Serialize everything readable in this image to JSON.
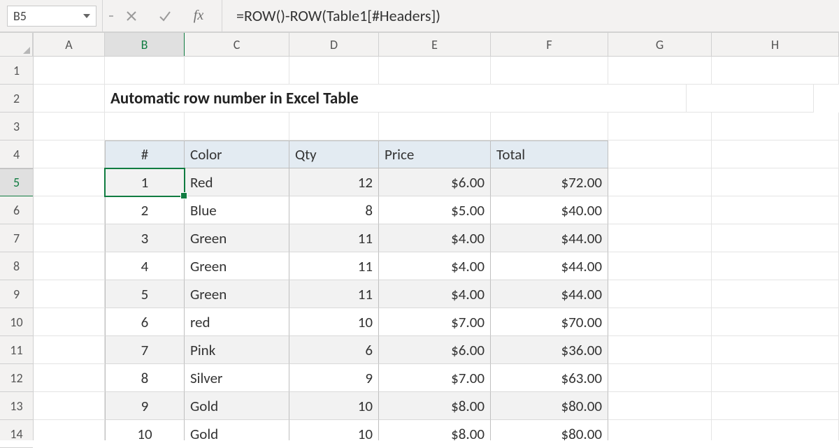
{
  "namebox": "B5",
  "formula": "=ROW()-ROW(Table1[#Headers])",
  "columns": [
    "A",
    "B",
    "C",
    "D",
    "E",
    "F",
    "G",
    "H"
  ],
  "row_numbers": [
    "1",
    "2",
    "3",
    "4",
    "5",
    "6",
    "7",
    "8",
    "9",
    "10",
    "11",
    "12",
    "13",
    "14"
  ],
  "title": "Automatic row number in Excel Table",
  "table": {
    "headers": {
      "num": "#",
      "color": "Color",
      "qty": "Qty",
      "price": "Price",
      "total": "Total"
    },
    "rows": [
      {
        "num": "1",
        "color": "Red",
        "qty": "12",
        "price": "$6.00",
        "total": "$72.00"
      },
      {
        "num": "2",
        "color": "Blue",
        "qty": "8",
        "price": "$5.00",
        "total": "$40.00"
      },
      {
        "num": "3",
        "color": "Green",
        "qty": "11",
        "price": "$4.00",
        "total": "$44.00"
      },
      {
        "num": "4",
        "color": "Green",
        "qty": "11",
        "price": "$4.00",
        "total": "$44.00"
      },
      {
        "num": "5",
        "color": "Green",
        "qty": "11",
        "price": "$4.00",
        "total": "$44.00"
      },
      {
        "num": "6",
        "color": "red",
        "qty": "10",
        "price": "$7.00",
        "total": "$70.00"
      },
      {
        "num": "7",
        "color": "Pink",
        "qty": "6",
        "price": "$6.00",
        "total": "$36.00"
      },
      {
        "num": "8",
        "color": "Silver",
        "qty": "9",
        "price": "$7.00",
        "total": "$63.00"
      },
      {
        "num": "9",
        "color": "Gold",
        "qty": "10",
        "price": "$8.00",
        "total": "$80.00"
      },
      {
        "num": "10",
        "color": "Gold",
        "qty": "10",
        "price": "$8.00",
        "total": "$80.00"
      }
    ]
  }
}
